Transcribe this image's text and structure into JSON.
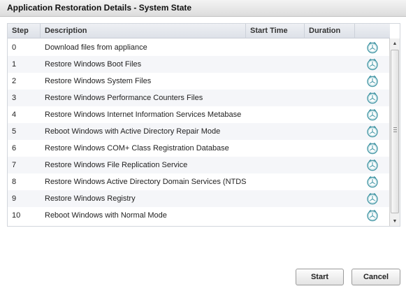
{
  "window": {
    "title": "Application Restoration Details - System State"
  },
  "table": {
    "columns": [
      "Step",
      "Description",
      "Start Time",
      "Duration",
      ""
    ],
    "rows": [
      {
        "step": "0",
        "description": "Download files from appliance",
        "start_time": "",
        "duration": "",
        "status_icon": "clock-icon"
      },
      {
        "step": "1",
        "description": "Restore Windows Boot Files",
        "start_time": "",
        "duration": "",
        "status_icon": "clock-icon"
      },
      {
        "step": "2",
        "description": "Restore Windows System Files",
        "start_time": "",
        "duration": "",
        "status_icon": "clock-icon"
      },
      {
        "step": "3",
        "description": "Restore Windows Performance Counters Files",
        "start_time": "",
        "duration": "",
        "status_icon": "clock-icon"
      },
      {
        "step": "4",
        "description": "Restore Windows Internet Information Services Metabase",
        "start_time": "",
        "duration": "",
        "status_icon": "clock-icon"
      },
      {
        "step": "5",
        "description": "Reboot Windows with Active Directory Repair Mode",
        "start_time": "",
        "duration": "",
        "status_icon": "clock-icon"
      },
      {
        "step": "6",
        "description": "Restore Windows COM+ Class Registration Database",
        "start_time": "",
        "duration": "",
        "status_icon": "clock-icon"
      },
      {
        "step": "7",
        "description": "Restore Windows File Replication Service",
        "start_time": "",
        "duration": "",
        "status_icon": "clock-icon"
      },
      {
        "step": "8",
        "description": "Restore Windows Active Directory Domain Services (NTDS",
        "start_time": "",
        "duration": "",
        "status_icon": "clock-icon"
      },
      {
        "step": "9",
        "description": "Restore Windows Registry",
        "start_time": "",
        "duration": "",
        "status_icon": "clock-icon"
      },
      {
        "step": "10",
        "description": "Reboot Windows with Normal Mode",
        "start_time": "",
        "duration": "",
        "status_icon": "clock-icon"
      }
    ]
  },
  "buttons": {
    "start": "Start",
    "cancel": "Cancel"
  },
  "colors": {
    "status_icon": "#4a9aa8"
  }
}
